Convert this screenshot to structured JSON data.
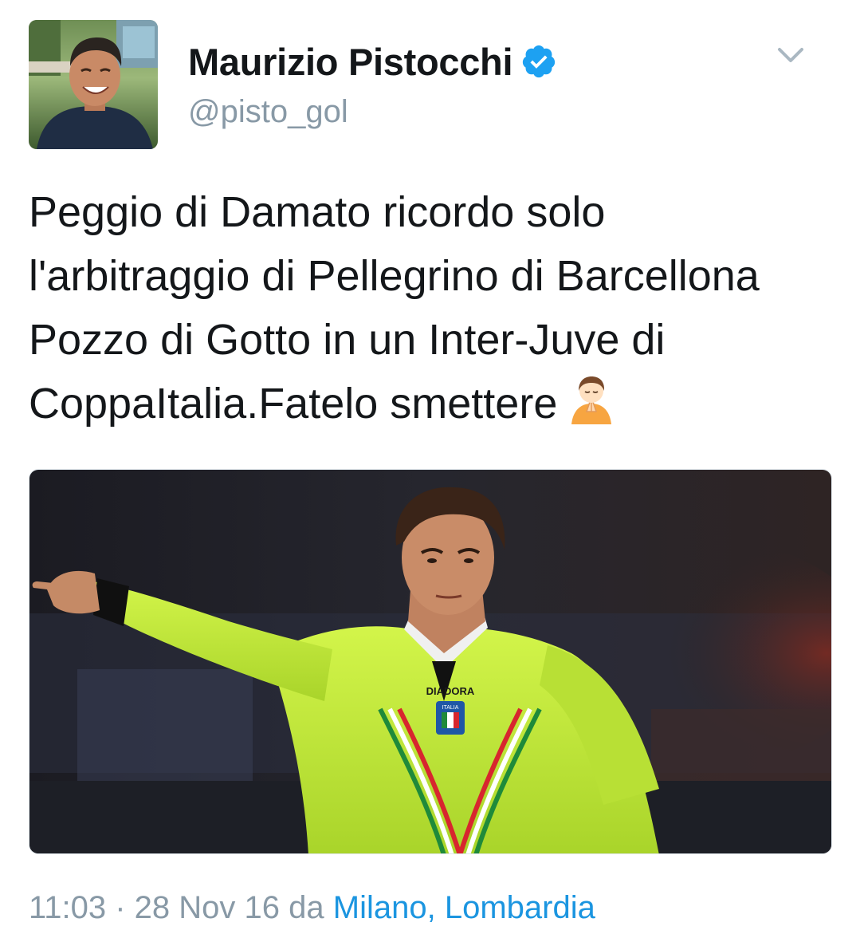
{
  "tweet": {
    "author": {
      "display_name": "Maurizio Pistocchi",
      "handle": "@pisto_gol",
      "verified": true
    },
    "text": "Peggio di Damato ricordo solo\nl'arbitraggio di Pellegrino di Barcellona\nPozzo di Gotto in un Inter-Juve di\nCoppaItalia.Fatelo smettere",
    "emoji": "person-with-folded-hands",
    "media": {
      "kind": "photo",
      "jersey_brand": "DIADORA",
      "badge_text": "ITALIA"
    },
    "timestamp": "11:03 · 28 Nov 16",
    "via": "da",
    "location": "Milano, Lombardia"
  },
  "colors": {
    "text_primary": "#14171a",
    "text_secondary": "#8899a6",
    "link": "#1b95e0",
    "verified": "#1da1f2",
    "jersey": "#c9f33a"
  },
  "icons": {
    "verified": "verified-badge-icon",
    "menu": "chevron-down-icon"
  }
}
